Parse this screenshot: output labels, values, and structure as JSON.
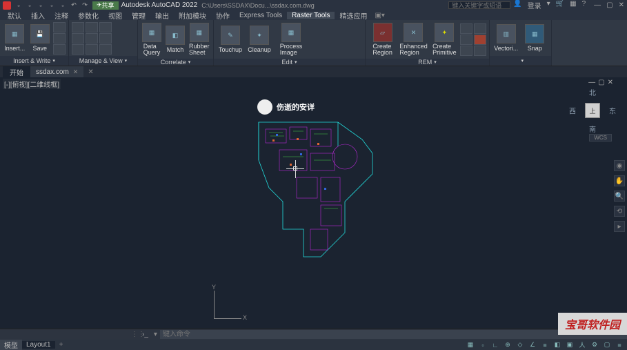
{
  "titlebar": {
    "share": "共享",
    "app_name": "Autodesk AutoCAD 2022",
    "doc_path": "C:\\Users\\SSDAX\\Docu...\\ssdax.com.dwg",
    "search_placeholder": "键入关键字或短语",
    "login": "登录"
  },
  "menu": {
    "items": [
      "默认",
      "插入",
      "注释",
      "参数化",
      "视图",
      "管理",
      "输出",
      "附加模块",
      "协作",
      "Express Tools",
      "Raster Tools",
      "精选应用"
    ],
    "active_index": 10
  },
  "ribbon": {
    "panels": [
      {
        "label": "Insert & Write",
        "buttons": [
          {
            "label": "Insert..."
          },
          {
            "label": "Save"
          }
        ]
      },
      {
        "label": "Manage & View",
        "buttons": [
          {
            "label": "Data\nQuery"
          },
          {
            "label": "Match"
          },
          {
            "label": "Rubber\nSheet"
          }
        ]
      },
      {
        "label": "Correlate",
        "buttons": [
          {
            "label": "Touchup"
          },
          {
            "label": "Cleanup"
          },
          {
            "label": "Process\nImage"
          }
        ]
      },
      {
        "label": "Edit",
        "buttons": [
          {
            "label": "Create\nRegion"
          },
          {
            "label": "Enhanced\nRegion"
          },
          {
            "label": "Create\nPrimitive"
          }
        ]
      },
      {
        "label": "REM",
        "buttons": []
      },
      {
        "label": "",
        "buttons": [
          {
            "label": "Vectori..."
          },
          {
            "label": "Snap"
          }
        ]
      }
    ]
  },
  "doctabs": {
    "start": "开始",
    "tab": "ssdax.com"
  },
  "view": {
    "label": "[-][俯视][二维线框]",
    "wcs": "WCS",
    "cube_top": "上",
    "n": "北",
    "s": "南",
    "e": "东",
    "w": "西",
    "ucs_x": "X",
    "ucs_y": "Y"
  },
  "watermark": {
    "text": "伤逝的安详"
  },
  "cmd": {
    "placeholder": "键入命令"
  },
  "status": {
    "model": "模型",
    "layout": "Layout1"
  },
  "corner": "宝哥软件园"
}
